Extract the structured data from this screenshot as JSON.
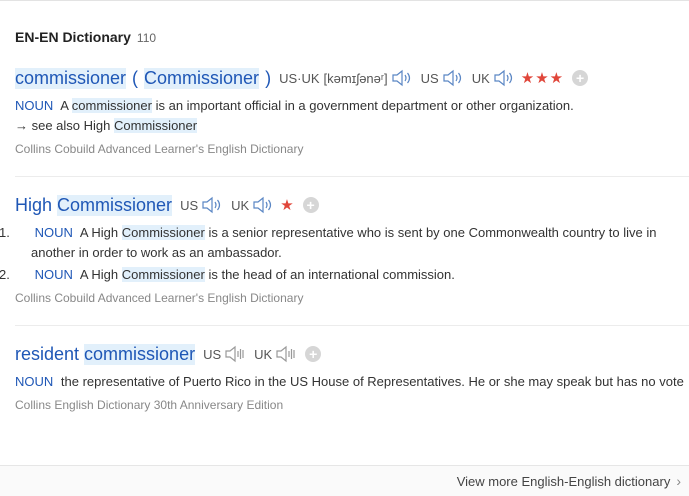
{
  "header": {
    "title": "EN-EN Dictionary",
    "count": "110"
  },
  "entries": [
    {
      "headword": "commissioner",
      "variant": "Commissioner",
      "phonetic_label": "US·UK",
      "phonetic": "[kəmɪʃənəʳ]",
      "us_label": "US",
      "uk_label": "UK",
      "stars": "★★★",
      "senses": [
        {
          "pos": "NOUN",
          "pre": "A",
          "hl": "commissioner",
          "post": "is an important official in a government department or other organization."
        }
      ],
      "see_also": {
        "prefix": "→ see also High",
        "hl": "Commissioner"
      },
      "source": "Collins Cobuild Advanced Learner's English Dictionary"
    },
    {
      "headword_pre": "High",
      "headword_hl": "Commissioner",
      "us_label": "US",
      "uk_label": "UK",
      "stars": "★",
      "senses": [
        {
          "num": "1.",
          "pos": "NOUN",
          "pre": "A High",
          "hl": "Commissioner",
          "post": "is a senior representative who is sent by one Commonwealth country to live in another in order to work as an ambassador."
        },
        {
          "num": "2.",
          "pos": "NOUN",
          "pre": "A High",
          "hl": "Commissioner",
          "post": "is the head of an international commission."
        }
      ],
      "source": "Collins Cobuild Advanced Learner's English Dictionary"
    },
    {
      "headword_pre": "resident",
      "headword_hl": "commissioner",
      "us_label": "US",
      "uk_label": "UK",
      "senses": [
        {
          "pos": "NOUN",
          "text": "the representative of Puerto Rico in the US House of Representatives. He or she may speak but has no vote"
        }
      ],
      "source": "Collins English Dictionary 30th Anniversary Edition"
    }
  ],
  "footer": {
    "more_label": "View more English-English dictionary"
  },
  "icons": {
    "speaker": "speaker-icon",
    "speaker_off": "speaker-disabled-icon",
    "add": "plus-icon",
    "chevron": "chevron-right-icon"
  },
  "colors": {
    "link": "#1f57b6",
    "highlight": "#e2f0fb",
    "star": "#e0463a"
  }
}
